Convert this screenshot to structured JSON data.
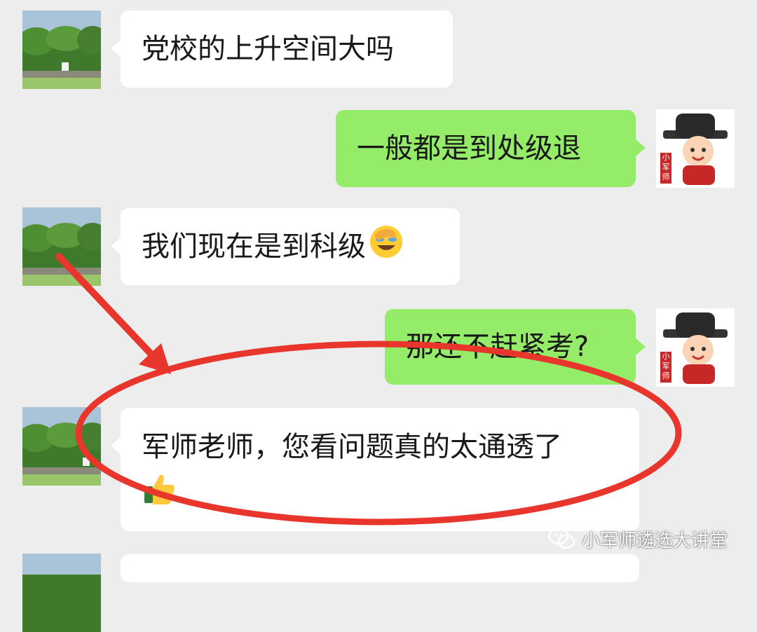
{
  "chat": {
    "messages": [
      {
        "sender": "other",
        "text": "党校的上升空间大吗"
      },
      {
        "sender": "self",
        "text": "一般都是到处级退"
      },
      {
        "sender": "other",
        "text": "我们现在是到科级",
        "emoji": "facepalm-laughing"
      },
      {
        "sender": "self",
        "text": "那还不赶紧考?"
      },
      {
        "sender": "other",
        "text": "军师老师，您看问题真的太通透了",
        "emoji": "thumbs-up"
      },
      {
        "sender": "other",
        "text": ""
      }
    ],
    "self_avatar_text": "小军师"
  },
  "watermark": {
    "text": "小军师遴选大讲堂",
    "icon": "wechat-icon"
  },
  "colors": {
    "background": "#ededed",
    "self_bubble": "#95ec69",
    "other_bubble": "#ffffff",
    "annotation": "#e8362c"
  }
}
